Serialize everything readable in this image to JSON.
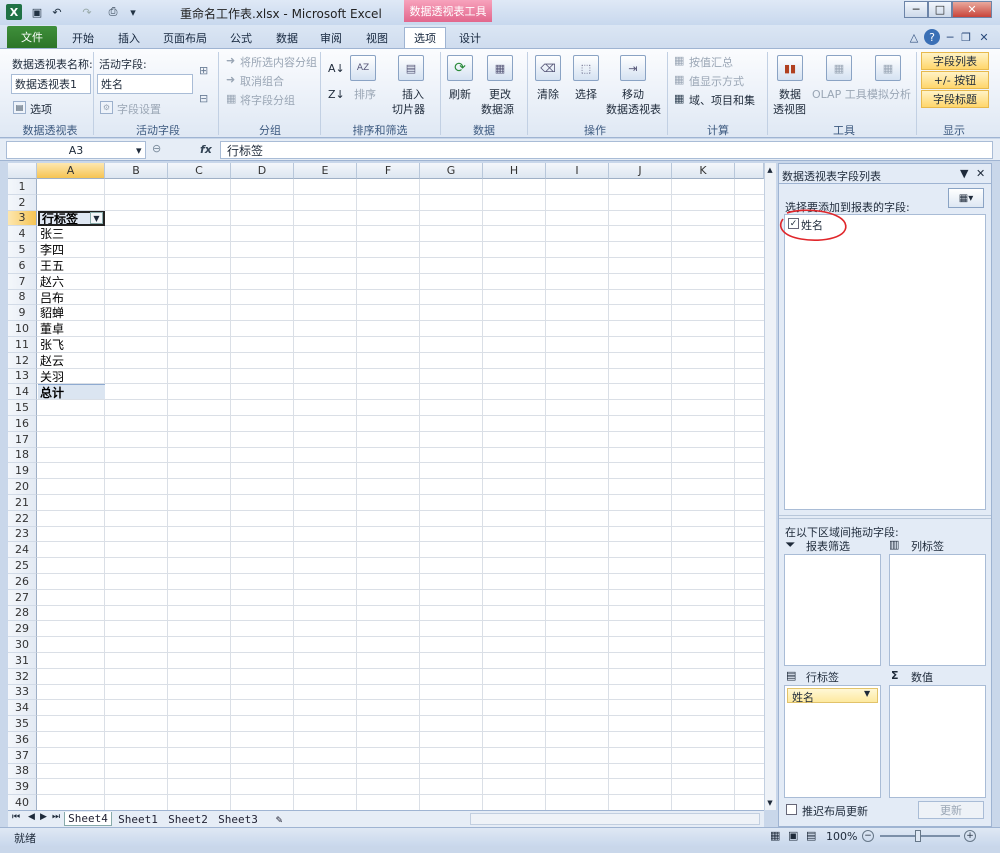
{
  "window": {
    "title": "重命名工作表.xlsx - Microsoft Excel",
    "context_tab_title": "数据透视表工具",
    "min": "─",
    "max": "□",
    "close": "✕"
  },
  "tabs": [
    {
      "label": "文件"
    },
    {
      "label": "开始"
    },
    {
      "label": "插入"
    },
    {
      "label": "页面布局"
    },
    {
      "label": "公式"
    },
    {
      "label": "数据"
    },
    {
      "label": "审阅"
    },
    {
      "label": "视图"
    },
    {
      "label": "选项"
    },
    {
      "label": "设计"
    }
  ],
  "ribbon": {
    "pivot_name_label": "数据透视表名称:",
    "pivot_name_value": "数据透视表1",
    "options_label": "选项",
    "group_pivot": "数据透视表",
    "active_field_label": "活动字段:",
    "active_field_value": "姓名",
    "field_settings": "字段设置",
    "group_active_field": "活动字段",
    "group_selection": "将所选内容分组",
    "ungroup": "取消组合",
    "group_field": "将字段分组",
    "group_group": "分组",
    "sort": "排序",
    "insert_slicer_1": "插入",
    "insert_slicer_2": "切片器",
    "group_sort_filter": "排序和筛选",
    "refresh": "刷新",
    "change_source_1": "更改",
    "change_source_2": "数据源",
    "group_data": "数据",
    "clear": "清除",
    "select": "选择",
    "move_1": "移动",
    "move_2": "数据透视表",
    "group_actions": "操作",
    "summarize_by": "按值汇总",
    "show_values_as": "值显示方式",
    "fields_items_sets": "域、项目和集",
    "group_calc": "计算",
    "pivotchart_1": "数据",
    "pivotchart_2": "透视图",
    "olap": "OLAP 工具",
    "whatif": "模拟分析",
    "group_tools": "工具",
    "field_list": "字段列表",
    "pm_buttons": "+/- 按钮",
    "field_headers": "字段标题",
    "group_show": "显示"
  },
  "formula_bar": {
    "name_box": "A3",
    "fx": "fx",
    "content": "行标签"
  },
  "grid": {
    "columns": [
      "A",
      "B",
      "C",
      "D",
      "E",
      "F",
      "G",
      "H",
      "I",
      "J",
      "K"
    ],
    "rows": [
      "1",
      "2",
      "3",
      "4",
      "5",
      "6",
      "7",
      "8",
      "9",
      "10",
      "11",
      "12",
      "13",
      "14",
      "15",
      "16",
      "17",
      "18",
      "19",
      "20",
      "21",
      "22",
      "23",
      "24",
      "25",
      "26",
      "27",
      "28",
      "29",
      "30",
      "31",
      "32",
      "33",
      "34",
      "35",
      "36",
      "37",
      "38",
      "39",
      "40"
    ],
    "cells": {
      "A3": "行标签",
      "A4": "张三",
      "A5": "李四",
      "A6": "王五",
      "A7": "赵六",
      "A8": "吕布",
      "A9": "貂蝉",
      "A10": "董卓",
      "A11": "张飞",
      "A12": "赵云",
      "A13": "关羽",
      "A14": "总计"
    }
  },
  "sheets": [
    "Sheet4",
    "Sheet1",
    "Sheet2",
    "Sheet3"
  ],
  "status": {
    "ready": "就绪",
    "zoom": "100%"
  },
  "panel": {
    "title": "数据透视表字段列表",
    "choose_label": "选择要添加到报表的字段:",
    "field_name": "姓名",
    "field_checked": true,
    "drag_label": "在以下区域间拖动字段:",
    "report_filter": "报表筛选",
    "column_labels": "列标签",
    "row_labels": "行标签",
    "values": "数值",
    "row_item": "姓名",
    "defer_label": "推迟布局更新",
    "update_button": "更新"
  },
  "colors": {
    "file_tab": "#2c7528",
    "context_tab": "#e2678d",
    "highlight": "#ffd66b",
    "annotation": "#e0262a"
  }
}
